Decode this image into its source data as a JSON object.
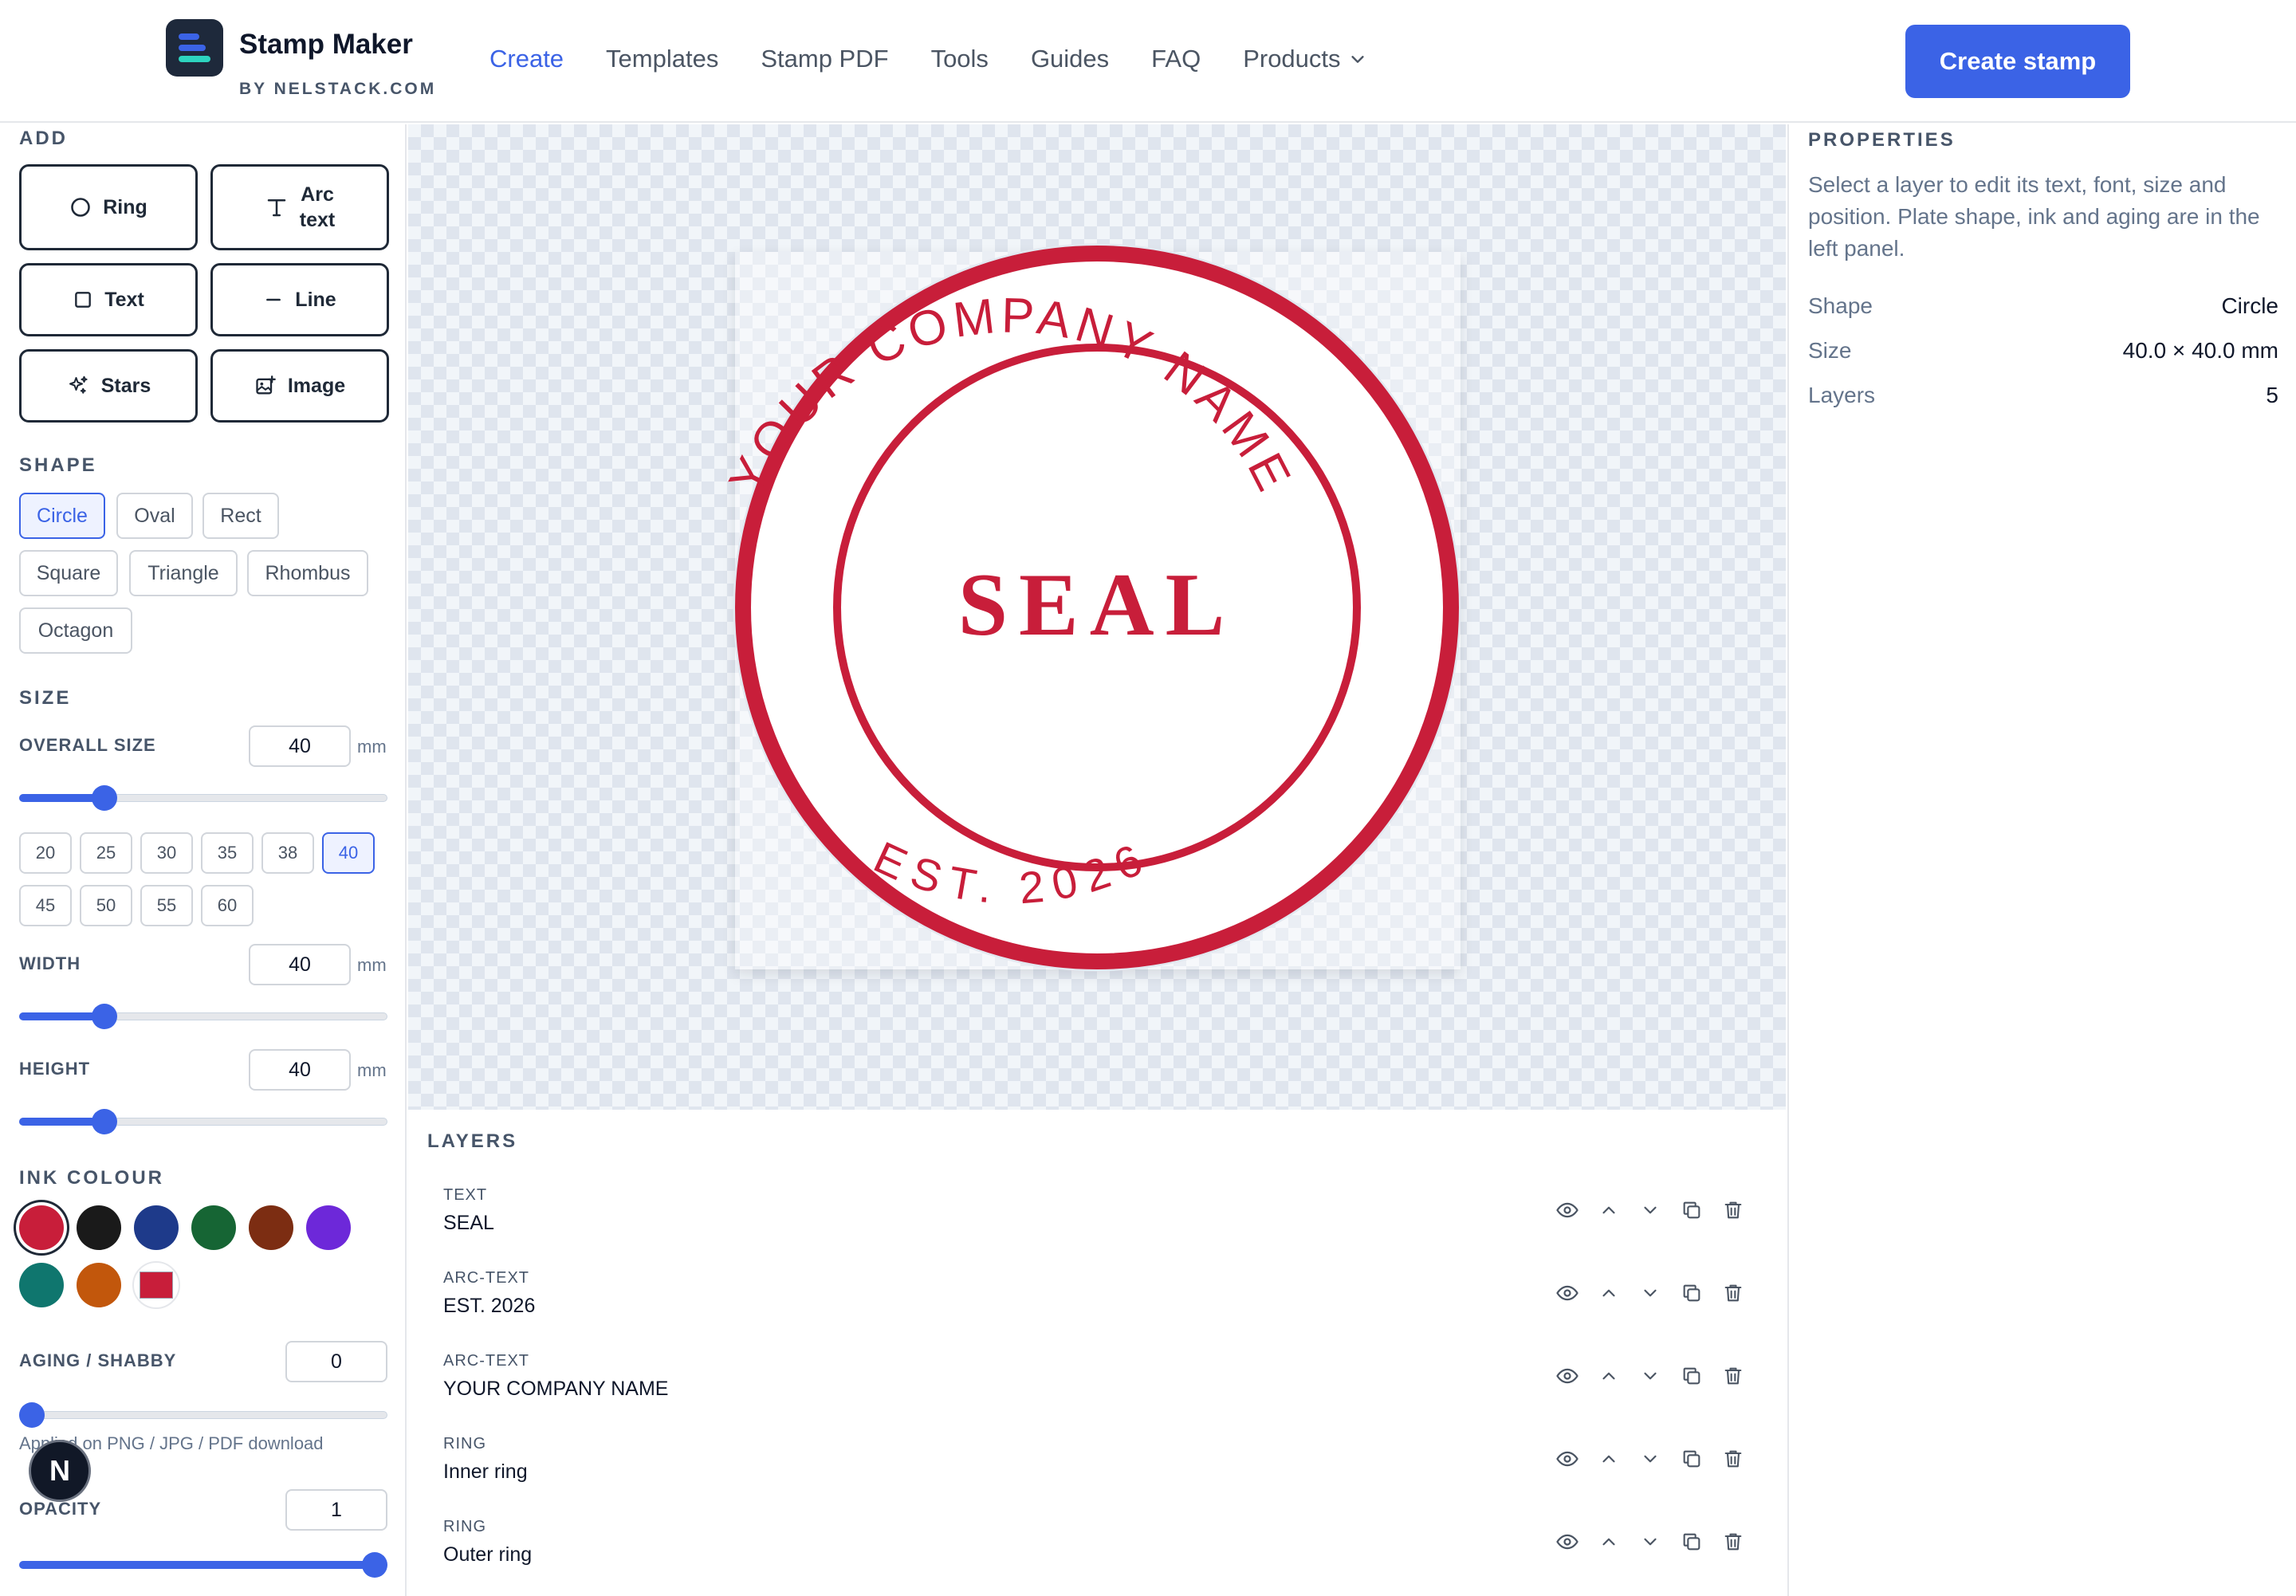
{
  "header": {
    "logo_title": "Stamp Maker",
    "logo_subtitle": "BY NELSTACK.COM",
    "nav": [
      "Create",
      "Templates",
      "Stamp PDF",
      "Tools",
      "Guides",
      "FAQ"
    ],
    "products_label": "Products",
    "create_button": "Create stamp",
    "accent": "#3b63e6"
  },
  "left": {
    "add_label": "ADD",
    "add_buttons": {
      "ring": "Ring",
      "arc_text_1": "Arc",
      "arc_text_2": "text",
      "text": "Text",
      "line": "Line",
      "stars": "Stars",
      "image": "Image"
    },
    "shape_label": "SHAPE",
    "shapes": [
      "Circle",
      "Oval",
      "Rect",
      "Square",
      "Triangle",
      "Rhombus",
      "Octagon"
    ],
    "selected_shape": "Circle",
    "size_label": "SIZE",
    "overall_size_label": "OVERALL SIZE",
    "overall_size": "40",
    "unit": "mm",
    "size_presets": [
      "20",
      "25",
      "30",
      "35",
      "38",
      "40",
      "45",
      "50",
      "55",
      "60"
    ],
    "selected_preset": "40",
    "width_label": "WIDTH",
    "width": "40",
    "height_label": "HEIGHT",
    "height": "40",
    "ink_label": "INK COLOUR",
    "ink_colors": [
      "#c81e3a",
      "#1a1a1a",
      "#1e3a8a",
      "#166534",
      "#7c2d12",
      "#6d28d9",
      "#0f766e",
      "#c2570c"
    ],
    "custom_ink": "#c81e3a",
    "aging_label": "AGING / SHABBY",
    "aging": "0",
    "aging_hint": "Applied on PNG / JPG / PDF download",
    "opacity_label": "OPACITY",
    "opacity": "1",
    "badge": "N"
  },
  "stamp": {
    "ink": "#c81e3a",
    "top_arc": "YOUR COMPANY NAME",
    "bottom_arc": "EST. 2026",
    "center": "SEAL"
  },
  "layers": {
    "label": "LAYERS",
    "items": [
      {
        "type": "TEXT",
        "name": "SEAL"
      },
      {
        "type": "ARC-TEXT",
        "name": "EST. 2026"
      },
      {
        "type": "ARC-TEXT",
        "name": "YOUR COMPANY NAME"
      },
      {
        "type": "RING",
        "name": "Inner ring"
      },
      {
        "type": "RING",
        "name": "Outer ring"
      }
    ]
  },
  "properties": {
    "label": "PROPERTIES",
    "description": "Select a layer to edit its text, font, size and position. Plate shape, ink and aging are in the left panel.",
    "rows": [
      {
        "k": "Shape",
        "v": "Circle"
      },
      {
        "k": "Size",
        "v": "40.0 × 40.0 mm"
      },
      {
        "k": "Layers",
        "v": "5"
      }
    ]
  }
}
